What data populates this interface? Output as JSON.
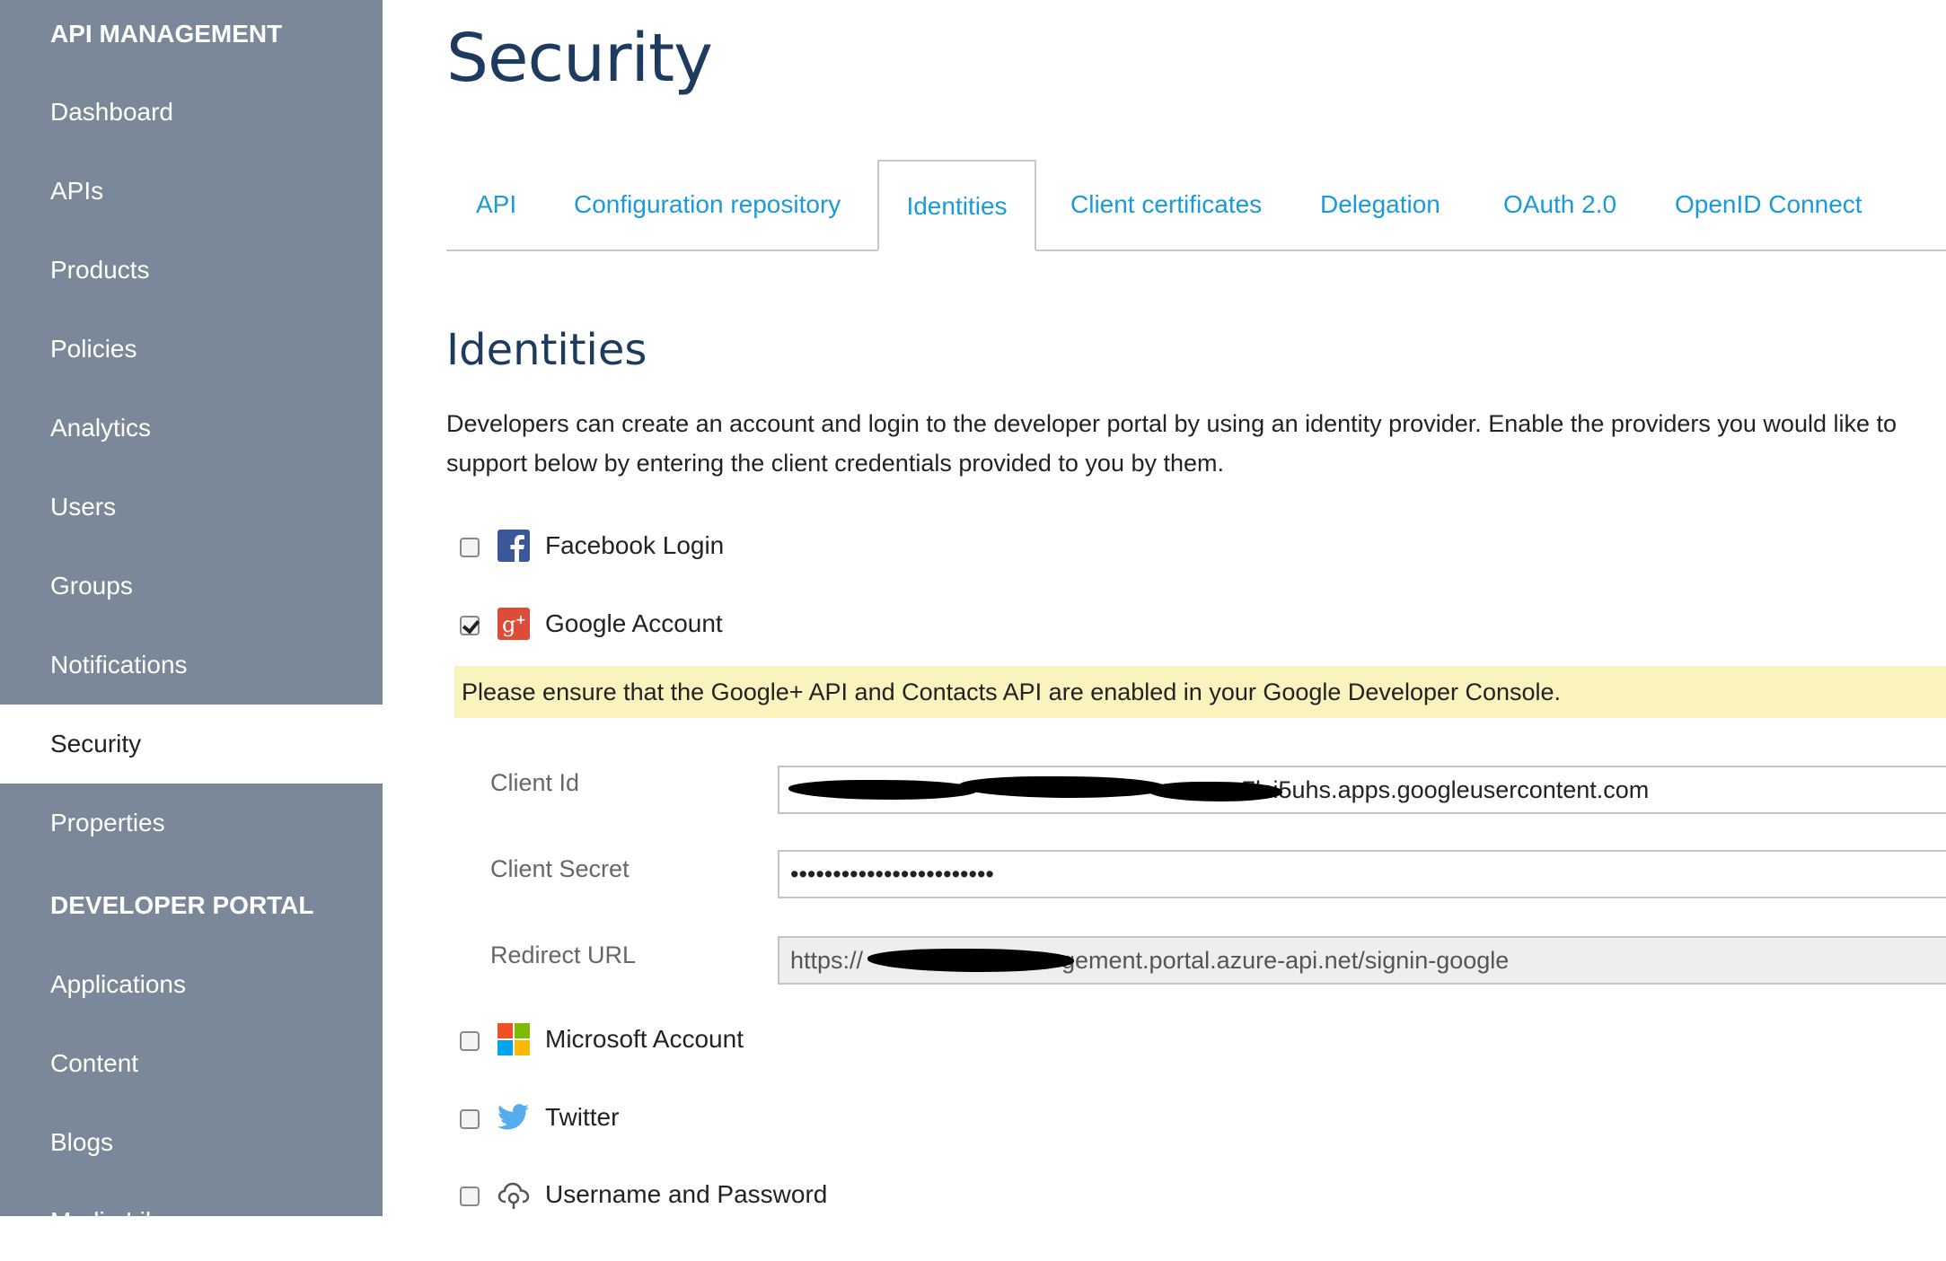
{
  "sidebar": {
    "sections": [
      {
        "title": "API MANAGEMENT"
      },
      {
        "title": "DEVELOPER PORTAL"
      }
    ],
    "items": [
      {
        "label": "Dashboard"
      },
      {
        "label": "APIs"
      },
      {
        "label": "Products"
      },
      {
        "label": "Policies"
      },
      {
        "label": "Analytics"
      },
      {
        "label": "Users"
      },
      {
        "label": "Groups"
      },
      {
        "label": "Notifications"
      },
      {
        "label": "Security"
      },
      {
        "label": "Properties"
      },
      {
        "label": "Applications"
      },
      {
        "label": "Content"
      },
      {
        "label": "Blogs"
      },
      {
        "label": "Media Library"
      }
    ],
    "active": "Security"
  },
  "page": {
    "title": "Security"
  },
  "tabs": [
    {
      "label": "API"
    },
    {
      "label": "Configuration repository"
    },
    {
      "label": "Identities"
    },
    {
      "label": "Client certificates"
    },
    {
      "label": "Delegation"
    },
    {
      "label": "OAuth 2.0"
    },
    {
      "label": "OpenID Connect"
    }
  ],
  "active_tab": "Identities",
  "identities": {
    "title": "Identities",
    "description": "Developers can create an account and login to the developer portal by using an identity provider. Enable the providers you would like to support below by entering the client credentials provided to you by them.",
    "providers": [
      {
        "label": "Facebook Login",
        "checked": false,
        "icon": "facebook-icon"
      },
      {
        "label": "Google Account",
        "checked": true,
        "icon": "google-plus-icon"
      },
      {
        "label": "Microsoft Account",
        "checked": false,
        "icon": "microsoft-icon"
      },
      {
        "label": "Twitter",
        "checked": false,
        "icon": "twitter-icon"
      },
      {
        "label": "Username and Password",
        "checked": false,
        "icon": "username-password-icon"
      }
    ],
    "google": {
      "notice": "Please ensure that the Google+ API and Contacts API are enabled in your Google Developer Console.",
      "client_id_label": "Client Id",
      "client_id_value": "7lci5uhs.apps.googleusercontent.com",
      "client_secret_label": "Client Secret",
      "client_secret_value": "••••••••••••••••••••••••",
      "redirect_url_label": "Redirect URL",
      "redirect_url_prefix": "https://",
      "redirect_url_suffix": "gement.portal.azure-api.net/signin-google"
    }
  },
  "colors": {
    "sidebar_bg": "#7a8899",
    "link": "#1a9ad6",
    "heading": "#1e3a5f",
    "notice_bg": "#fbf3bd"
  }
}
